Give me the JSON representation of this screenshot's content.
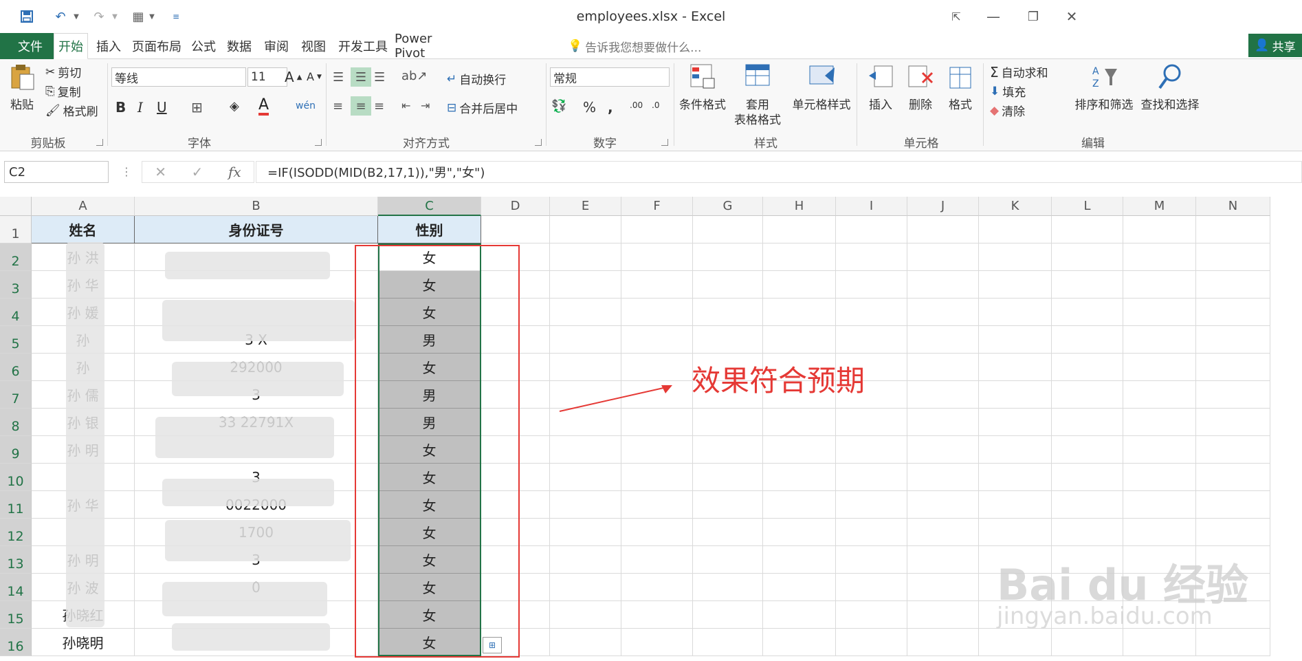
{
  "window": {
    "title": "employees.xlsx - Excel"
  },
  "tabs": {
    "file": "文件",
    "items": [
      "开始",
      "插入",
      "页面布局",
      "公式",
      "数据",
      "审阅",
      "视图",
      "开发工具",
      "Power Pivot"
    ],
    "active_index": 0,
    "tell_me": "告诉我您想要做什么...",
    "share": "共享"
  },
  "ribbon": {
    "clipboard": {
      "paste": "粘贴",
      "cut": "剪切",
      "copy": "复制",
      "format_painter": "格式刷",
      "label": "剪贴板"
    },
    "font": {
      "name": "等线",
      "size": "11",
      "label": "字体"
    },
    "alignment": {
      "wrap": "自动换行",
      "merge": "合并后居中",
      "label": "对齐方式"
    },
    "number": {
      "format": "常规",
      "label": "数字"
    },
    "styles": {
      "conditional": "条件格式",
      "table_line1": "套用",
      "table_line2": "表格格式",
      "cell_styles": "单元格样式",
      "label": "样式"
    },
    "cells": {
      "insert": "插入",
      "delete": "删除",
      "format": "格式",
      "label": "单元格"
    },
    "editing": {
      "autosum": "自动求和",
      "fill": "填充",
      "clear": "清除",
      "sort": "排序和筛选",
      "find": "查找和选择",
      "label": "编辑"
    }
  },
  "formula_bar": {
    "name_box": "C2",
    "fx": "fx",
    "formula": "=IF(ISODD(MID(B2,17,1)),\"男\",\"女\")"
  },
  "sheet": {
    "columns": [
      "A",
      "B",
      "C",
      "D",
      "E",
      "F",
      "G",
      "H",
      "I",
      "J",
      "K",
      "L",
      "M",
      "N"
    ],
    "row_numbers": [
      "1",
      "2",
      "3",
      "4",
      "5",
      "6",
      "7",
      "8",
      "9",
      "10",
      "11",
      "12",
      "13",
      "14",
      "15",
      "16"
    ],
    "headers": [
      "姓名",
      "身份证号",
      "性别"
    ],
    "names": [
      "孙 洪",
      "孙 华",
      "孙 媛",
      "孙",
      "孙",
      "孙 儒",
      "孙 银",
      "孙 明",
      "",
      "孙 华",
      "",
      "孙 明",
      "孙 波",
      "孙晓红",
      "孙晓明"
    ],
    "id_fragments": [
      "",
      "",
      "",
      "3 X",
      "292000",
      "3",
      "33 22791X",
      "",
      "3",
      "0022000",
      "1700",
      "3",
      "0",
      "",
      ""
    ],
    "genders": [
      "女",
      "女",
      "女",
      "男",
      "女",
      "男",
      "男",
      "女",
      "女",
      "女",
      "女",
      "女",
      "女",
      "女",
      "女"
    ]
  },
  "annotation": {
    "text": "效果符合预期",
    "color": "#e53935"
  },
  "watermark": {
    "brand": "Bai du 经验",
    "url": "jingyan.baidu.com"
  }
}
